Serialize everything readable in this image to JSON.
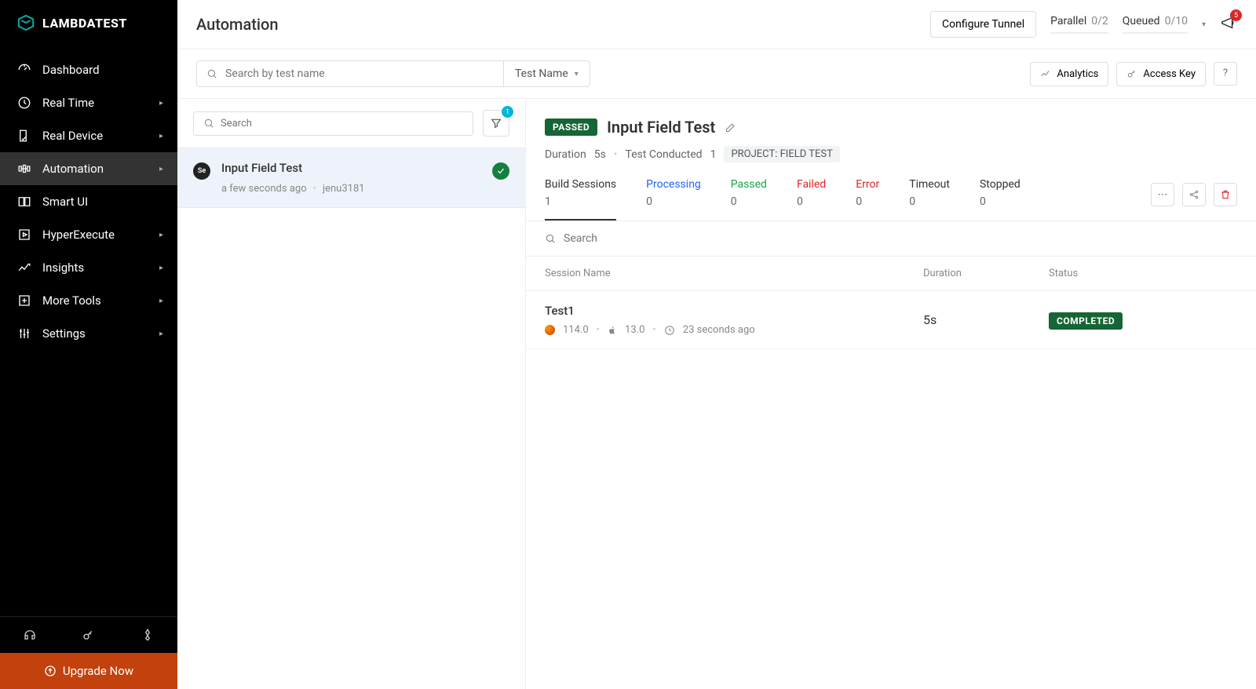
{
  "brand": "LAMBDATEST",
  "sidebar": {
    "items": [
      {
        "label": "Dashboard",
        "icon": "gauge",
        "expandable": false
      },
      {
        "label": "Real Time",
        "icon": "clock",
        "expandable": true
      },
      {
        "label": "Real Device",
        "icon": "device-check",
        "expandable": true
      },
      {
        "label": "Automation",
        "icon": "automation",
        "expandable": true,
        "active": true
      },
      {
        "label": "Smart UI",
        "icon": "panels",
        "expandable": false
      },
      {
        "label": "HyperExecute",
        "icon": "play-box",
        "expandable": true
      },
      {
        "label": "Insights",
        "icon": "trend",
        "expandable": true
      },
      {
        "label": "More Tools",
        "icon": "plus-box",
        "expandable": true
      },
      {
        "label": "Settings",
        "icon": "sliders",
        "expandable": true
      }
    ],
    "upgrade": "Upgrade Now"
  },
  "top": {
    "page_title": "Automation",
    "configure_tunnel": "Configure Tunnel",
    "parallel_label": "Parallel",
    "parallel_value": "0/2",
    "queued_label": "Queued",
    "queued_value": "0/10",
    "notif_count": "5"
  },
  "secondbar": {
    "search_placeholder": "Search by test name",
    "dropdown_label": "Test Name",
    "analytics": "Analytics",
    "access_key": "Access Key",
    "help": "?"
  },
  "list": {
    "search_placeholder": "Search",
    "filter_badge": "1",
    "build": {
      "name": "Input Field Test",
      "time": "a few seconds ago",
      "user": "jenu3181",
      "runner": "Se"
    }
  },
  "detail": {
    "status": "PASSED",
    "title": "Input Field Test",
    "duration_label": "Duration",
    "duration_value": "5s",
    "conducted_label": "Test Conducted",
    "conducted_value": "1",
    "project_chip": "PROJECT: FIELD TEST",
    "tabs": [
      {
        "key": "build",
        "label": "Build Sessions",
        "count": "1"
      },
      {
        "key": "processing",
        "label": "Processing",
        "count": "0"
      },
      {
        "key": "passed",
        "label": "Passed",
        "count": "0"
      },
      {
        "key": "failed",
        "label": "Failed",
        "count": "0"
      },
      {
        "key": "error",
        "label": "Error",
        "count": "0"
      },
      {
        "key": "timeout",
        "label": "Timeout",
        "count": "0"
      },
      {
        "key": "stopped",
        "label": "Stopped",
        "count": "0"
      }
    ],
    "session_search_placeholder": "Search",
    "columns": {
      "name": "Session Name",
      "duration": "Duration",
      "status": "Status"
    },
    "session": {
      "name": "Test1",
      "browser_version": "114.0",
      "os_version": "13.0",
      "time_ago": "23 seconds ago",
      "duration": "5s",
      "status": "COMPLETED"
    }
  }
}
